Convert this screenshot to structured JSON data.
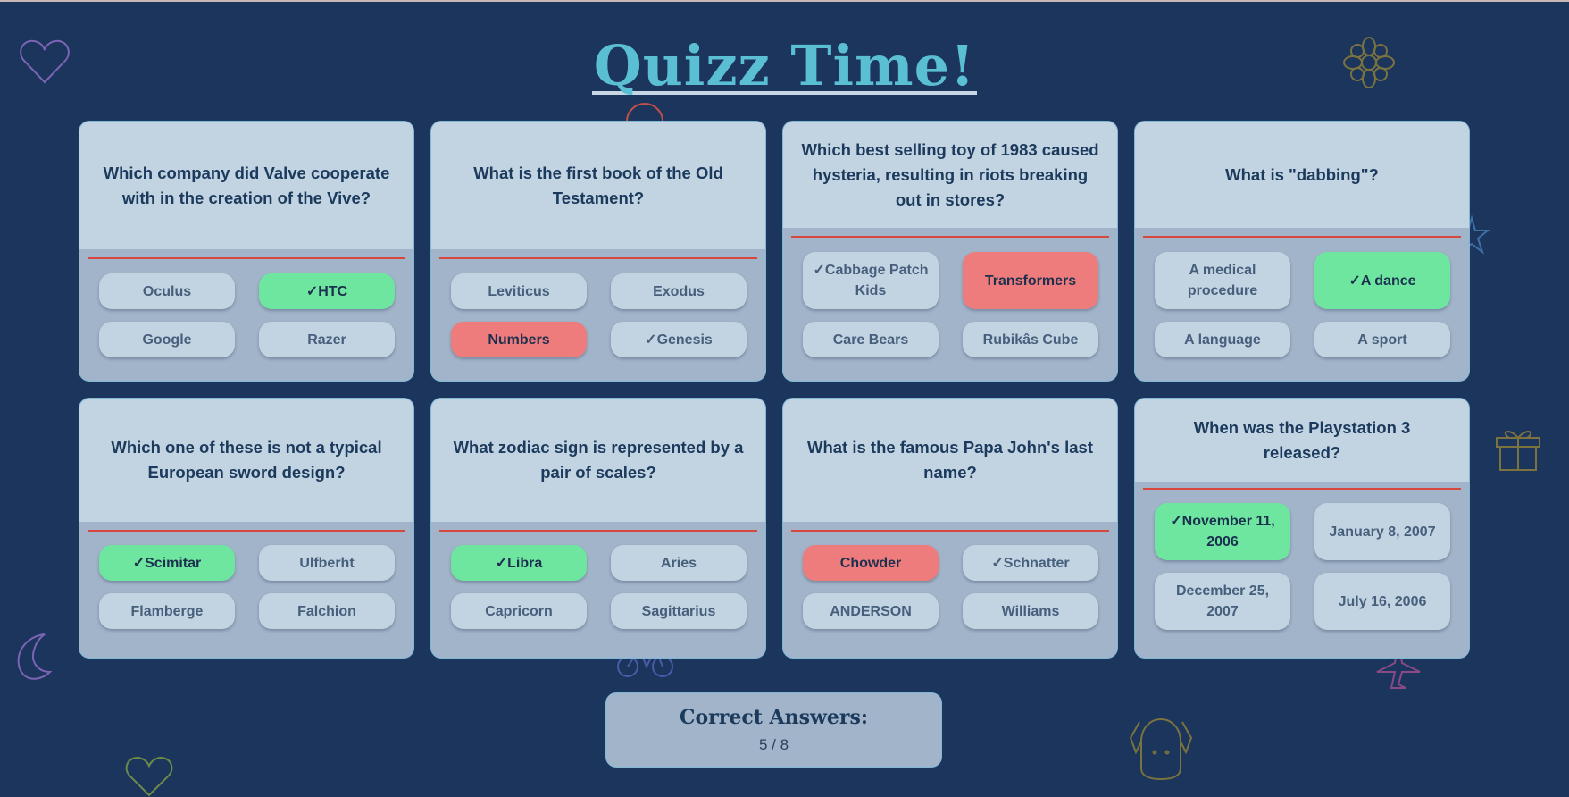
{
  "page": {
    "title": "Quizz Time!",
    "colors": {
      "background": "#1b355c",
      "title": "#5bbfd3",
      "correct": "#6ee6a0",
      "wrong": "#ef7c7c",
      "card": "#a2b4c9",
      "question_bg": "#c2d3e2",
      "separator": "#d7473f"
    }
  },
  "questions": [
    {
      "text": "Which company did Valve cooperate with in the creation of the Vive?",
      "answers": [
        {
          "label": "Oculus",
          "state": "none"
        },
        {
          "label": "✓HTC",
          "state": "correct"
        },
        {
          "label": "Google",
          "state": "none"
        },
        {
          "label": "Razer",
          "state": "none"
        }
      ]
    },
    {
      "text": "What is the first book of the Old Testament?",
      "answers": [
        {
          "label": "Leviticus",
          "state": "none"
        },
        {
          "label": "Exodus",
          "state": "none"
        },
        {
          "label": "Numbers",
          "state": "wrong"
        },
        {
          "label": "✓Genesis",
          "state": "none"
        }
      ]
    },
    {
      "text": "Which best selling toy of 1983 caused hysteria, resulting in riots breaking out in stores?",
      "answers": [
        {
          "label": "✓Cabbage Patch Kids",
          "state": "none"
        },
        {
          "label": "Transformers",
          "state": "wrong"
        },
        {
          "label": "Care Bears",
          "state": "none"
        },
        {
          "label": "Rubikâs Cube",
          "state": "none"
        }
      ]
    },
    {
      "text": "What is \"dabbing\"?",
      "answers": [
        {
          "label": "A medical procedure",
          "state": "none"
        },
        {
          "label": "✓A dance",
          "state": "correct"
        },
        {
          "label": "A language",
          "state": "none"
        },
        {
          "label": "A sport",
          "state": "none"
        }
      ]
    },
    {
      "text": "Which one of these is not a typical European sword design?",
      "answers": [
        {
          "label": "✓Scimitar",
          "state": "correct"
        },
        {
          "label": "Ulfberht",
          "state": "none"
        },
        {
          "label": "Flamberge",
          "state": "none"
        },
        {
          "label": "Falchion",
          "state": "none"
        }
      ]
    },
    {
      "text": "What zodiac sign is represented by a pair of scales?",
      "answers": [
        {
          "label": "✓Libra",
          "state": "correct"
        },
        {
          "label": "Aries",
          "state": "none"
        },
        {
          "label": "Capricorn",
          "state": "none"
        },
        {
          "label": "Sagittarius",
          "state": "none"
        }
      ]
    },
    {
      "text": "What is the famous Papa John's last name?",
      "answers": [
        {
          "label": "Chowder",
          "state": "wrong"
        },
        {
          "label": "✓Schnatter",
          "state": "none"
        },
        {
          "label": "ANDERSON",
          "state": "none"
        },
        {
          "label": "Williams",
          "state": "none"
        }
      ]
    },
    {
      "text": "When was the Playstation 3 released?",
      "answers": [
        {
          "label": "✓November 11, 2006",
          "state": "correct"
        },
        {
          "label": "January 8, 2007",
          "state": "none"
        },
        {
          "label": "December 25, 2007",
          "state": "none"
        },
        {
          "label": "July 16, 2006",
          "state": "none"
        }
      ]
    }
  ],
  "score": {
    "label": "Correct Answers:",
    "value": "5 / 8"
  }
}
